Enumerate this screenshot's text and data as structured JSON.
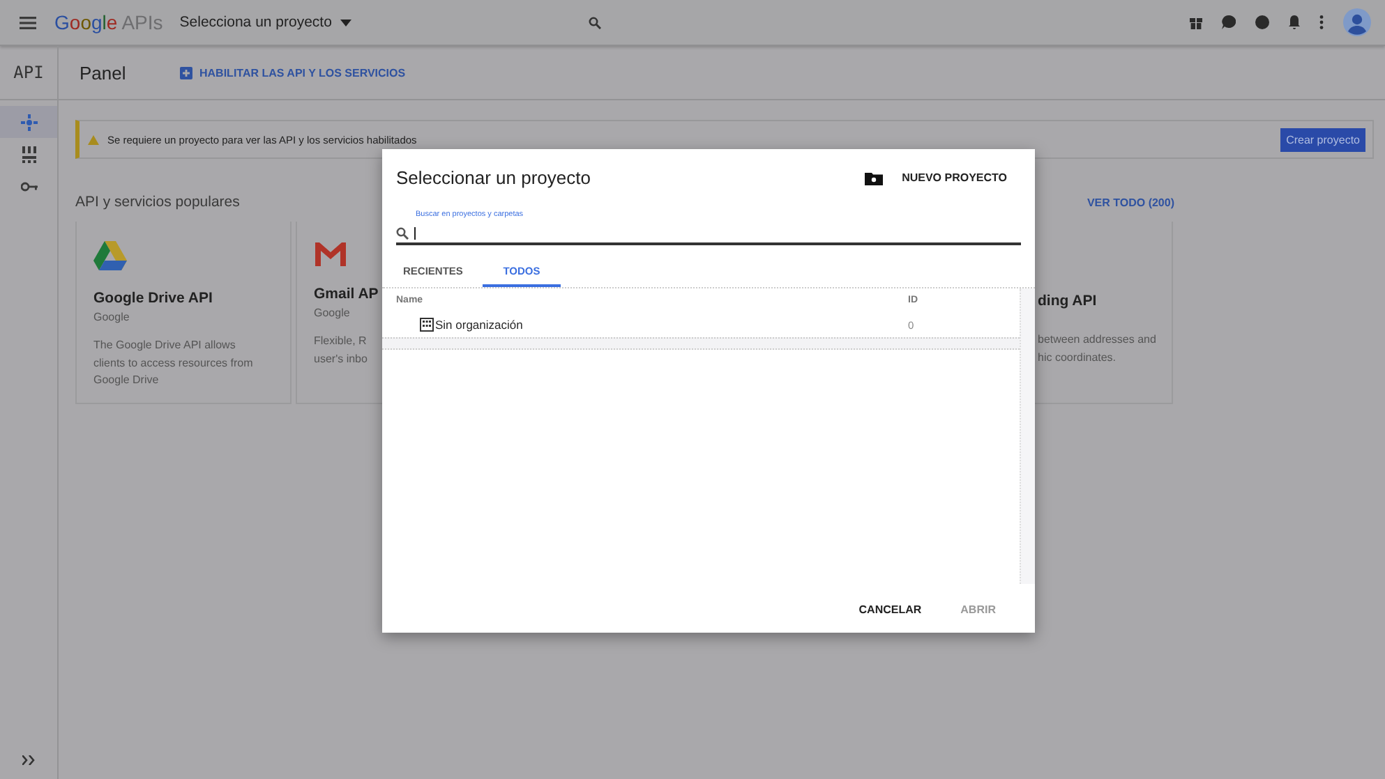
{
  "top_bar": {
    "logo": {
      "brand": "Google",
      "product": "APIs"
    },
    "project_picker": "Selecciona un proyecto"
  },
  "sidebar": {
    "title": "API",
    "items": [
      {
        "kind": "dashboard",
        "selected": true
      },
      {
        "kind": "library",
        "selected": false
      },
      {
        "kind": "credentials",
        "selected": false
      }
    ]
  },
  "header": {
    "title": "Panel",
    "action": "HABILITAR LAS API Y LOS SERVICIOS"
  },
  "banner": {
    "message": "Se requiere un proyecto para ver las API y los servicios habilitados",
    "button": "Crear proyecto"
  },
  "popular": {
    "title": "API y servicios populares",
    "see_all": "VER TODO (200)",
    "cards": [
      {
        "kind": "drive",
        "name": "Google Drive API",
        "vendor": "Google",
        "description": [
          "The Google Drive API allows",
          "clients to access resources from",
          "Google Drive"
        ]
      },
      {
        "kind": "gmail",
        "name": "Gmail AP",
        "vendor": "Google",
        "description": [
          "Flexible, R",
          "user's inbo"
        ]
      },
      {
        "kind": "partial",
        "name": "ding API",
        "description": [
          "between addresses and",
          "hic coordinates."
        ]
      }
    ]
  },
  "dialog": {
    "title": "Seleccionar un proyecto",
    "new_project": "NUEVO PROYECTO",
    "search": {
      "label": "Buscar en proyectos y carpetas"
    },
    "tabs": [
      {
        "label": "RECIENTES",
        "selected": false
      },
      {
        "label": "TODOS",
        "selected": true
      }
    ],
    "table": {
      "columns": [
        "Name",
        "ID"
      ],
      "rows": [
        {
          "name": "Sin organización",
          "id": "0"
        }
      ]
    },
    "buttons": [
      {
        "label": "CANCELAR",
        "disabled": false
      },
      {
        "label": "ABRIR",
        "disabled": true
      }
    ]
  }
}
